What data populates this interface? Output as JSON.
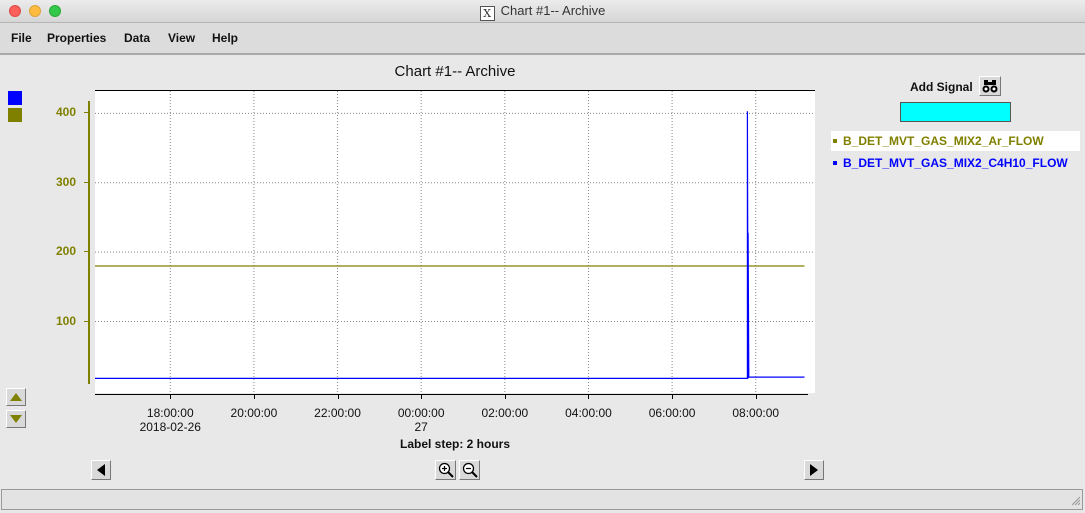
{
  "window": {
    "title": "Chart #1-- Archive"
  },
  "menu": [
    "File",
    "Properties",
    "Data",
    "View",
    "Help"
  ],
  "colors": {
    "ar_flow": "#808000",
    "c4h10_flow": "#0000ff",
    "add_signal_input": "#00ffff"
  },
  "add_signal": {
    "label": "Add Signal",
    "icon": "binoculars-icon",
    "value": ""
  },
  "signals": [
    {
      "name": "B_DET_MVT_GAS_MIX2_Ar_FLOW",
      "color": "#808000"
    },
    {
      "name": "B_DET_MVT_GAS_MIX2_C4H10_FLOW",
      "color": "#0000ff"
    }
  ],
  "navigation": {
    "label_step": "Label step: 2 hours",
    "icons": [
      "scroll-left-icon",
      "zoom-in-icon",
      "zoom-out-icon",
      "scroll-right-icon"
    ]
  },
  "chart_data": {
    "type": "line",
    "title": "Chart #1-- Archive",
    "x_ticks": [
      {
        "time": "18:00:00",
        "date": "2018-02-26"
      },
      {
        "time": "20:00:00",
        "date": ""
      },
      {
        "time": "22:00:00",
        "date": ""
      },
      {
        "time": "00:00:00",
        "date": "27"
      },
      {
        "time": "02:00:00",
        "date": ""
      },
      {
        "time": "04:00:00",
        "date": ""
      },
      {
        "time": "06:00:00",
        "date": ""
      },
      {
        "time": "08:00:00",
        "date": ""
      }
    ],
    "xlim": [
      "2018-02-26 16:12",
      "2018-02-27 09:15"
    ],
    "y_ticks": [
      100,
      200,
      300,
      400
    ],
    "ylim": [
      10,
      415
    ],
    "grid": true,
    "series": [
      {
        "name": "B_DET_MVT_GAS_MIX2_Ar_FLOW",
        "color": "#808000",
        "points": [
          [
            "2018-02-26 16:12",
            180
          ],
          [
            "2018-02-27 09:10",
            180
          ]
        ]
      },
      {
        "name": "B_DET_MVT_GAS_MIX2_C4H10_FLOW",
        "color": "#0000ff",
        "points": [
          [
            "2018-02-26 16:12",
            18
          ],
          [
            "2018-02-27 07:48",
            18
          ],
          [
            "2018-02-27 07:48",
            403
          ],
          [
            "2018-02-27 07:49",
            18
          ],
          [
            "2018-02-27 07:49",
            228
          ],
          [
            "2018-02-27 07:50",
            20
          ],
          [
            "2018-02-27 09:10",
            20
          ]
        ]
      }
    ]
  }
}
